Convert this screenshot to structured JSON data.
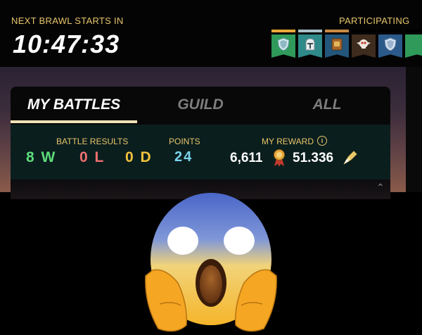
{
  "header": {
    "next_brawl_label": "NEXT BRAWL STARTS IN",
    "timer": "10:47:33",
    "participating_label": "PARTICIPATING"
  },
  "participants": [
    {
      "icon": "shield-emblem",
      "topbar_color": "#e8a83a",
      "banner_color": "#2f9a5a"
    },
    {
      "icon": "knight-helmet-emblem",
      "topbar_color": "#a9c0c6",
      "banner_color": "#2f8a8a"
    },
    {
      "icon": "book-emblem",
      "topbar_color": "#c88a44",
      "banner_color": "#23567a"
    },
    {
      "icon": "skull-wings-emblem",
      "topbar_color": "#000000",
      "banner_color": "#3e2c1e"
    },
    {
      "icon": "shield-emblem",
      "topbar_color": "#000000",
      "banner_color": "#2b5a8a"
    },
    {
      "icon": "banner-partial",
      "topbar_color": "#000000",
      "banner_color": "#2f9a5a"
    }
  ],
  "tabs": [
    {
      "label": "MY BATTLES",
      "active": true
    },
    {
      "label": "GUILD",
      "active": false
    },
    {
      "label": "ALL",
      "active": false
    }
  ],
  "summary": {
    "battle_results_label": "BATTLE RESULTS",
    "wins": "8 W",
    "losses": "0 L",
    "draws": "0 D",
    "points_label": "POINTS",
    "points": "24",
    "my_reward_label": "MY REWARD",
    "reward_merits": "6,611",
    "reward_shards": "51.336"
  },
  "overlay": {
    "icon": "screaming-in-fear-emoji"
  },
  "colors": {
    "gold_label": "#e8c56a",
    "wins": "#5ddc7a",
    "losses": "#f06e6e",
    "draws": "#f2c23d",
    "points": "#7ad4ee",
    "active_tab_underline": "#f0e2b6"
  }
}
